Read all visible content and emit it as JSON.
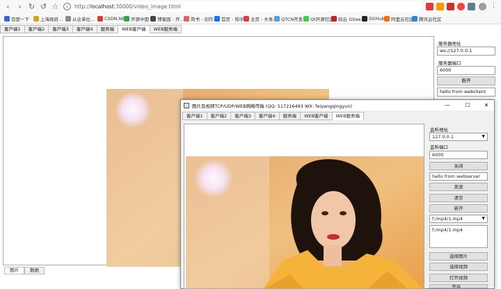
{
  "browser": {
    "url_prefix": "http://",
    "url_host": "localhost",
    "url_rest": ":30000/video_image.html",
    "bookmarks": [
      {
        "label": "百度一下",
        "color": "#2e64e6"
      },
      {
        "label": "上海政府…",
        "color": "#d6a11b"
      },
      {
        "label": "从业单位…",
        "color": "#8a8a8a"
      },
      {
        "label": "CSDN.NET",
        "color": "#e0392b"
      },
      {
        "label": "开源中国",
        "color": "#2aa84a"
      },
      {
        "label": "博客园 - 开…",
        "color": "#444444"
      },
      {
        "label": "简书 - 创作…",
        "color": "#e06650"
      },
      {
        "label": "首页 - 知乎",
        "color": "#1772f6"
      },
      {
        "label": "主页 - 头条…",
        "color": "#e4393c"
      },
      {
        "label": "QTCN开发…",
        "color": "#4aa2e8"
      },
      {
        "label": "Qt开源社区",
        "color": "#41cd52"
      },
      {
        "label": "码云 Gitee…",
        "color": "#c71d23"
      },
      {
        "label": "GitHub",
        "color": "#222222"
      },
      {
        "label": "阿里云社区",
        "color": "#ff6a00"
      },
      {
        "label": "腾讯云社区",
        "color": "#1e88e5"
      }
    ]
  },
  "page": {
    "tabs": [
      "客户端1",
      "客户端2",
      "客户端3",
      "客户端4",
      "服务端",
      "WEB客户端",
      "WEB服务端"
    ],
    "active_tab": 5,
    "bottom_tabs": [
      "图片",
      "数据"
    ],
    "right_panel": {
      "server_addr_label": "服务器地址",
      "server_addr_value": "ws://127.0.0.1",
      "server_port_label": "服务器端口",
      "server_port_value": "6000",
      "disconnect_button": "断开",
      "message_value": "hello from webclient"
    }
  },
  "window": {
    "title": "图片及视频TCP/UDP/WEB网络传输 (QQ: 517216493 WX: feiyangqingyun)",
    "minimize": "—",
    "maximize": "☐",
    "close": "✕",
    "tabs": [
      "客户端1",
      "客户端2",
      "客户端3",
      "客户端4",
      "服务端",
      "WEB客户端",
      "WEB服务端"
    ],
    "active_tab": 6,
    "panel": {
      "listen_addr_label": "监听地址",
      "listen_addr_value": "127.0.0.1",
      "listen_port_label": "监听端口",
      "listen_port_value": "6000",
      "close_button": "关闭",
      "message_value": "hello from webserver",
      "send_button": "发送",
      "clear_button": "清空",
      "new_button": "新开",
      "file_select_value": "f:/mp4/1.mp4",
      "file_text_value": "f:/mp4/1.mp4",
      "select_image_button": "选择图片",
      "select_video_button": "选择视频",
      "open_video_button": "打开视频",
      "partial_button": "开启…"
    }
  },
  "colors": {
    "accent_active_tab": "#ffffff",
    "chrome_bg": "#f7f7f7"
  }
}
